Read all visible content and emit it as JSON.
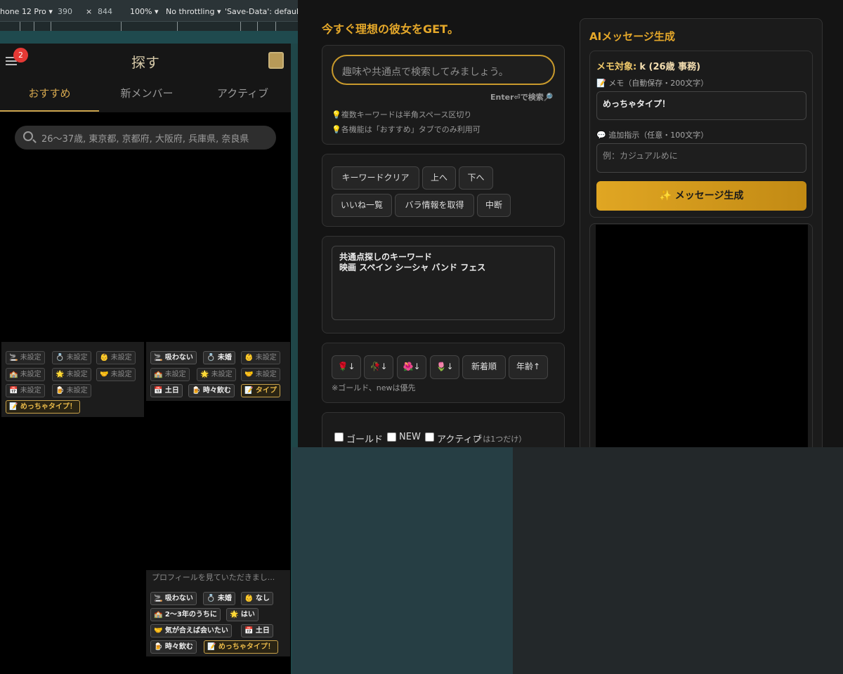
{
  "devtools": {
    "device": "hone 12 Pro",
    "width": "390",
    "x": "×",
    "height": "844",
    "zoom": "100%",
    "throttle": "No throttling",
    "savedata": "'Save-Data': default"
  },
  "app": {
    "badge": "2",
    "title": "探す",
    "tabs": [
      "おすすめ",
      "新メンバー",
      "アクティブ"
    ],
    "search_placeholder": "26〜37歳, 東京都, 京都府, 大阪府, 兵庫県, 奈良県"
  },
  "card1": {
    "tags": [
      "🚬 未設定",
      "💍 未設定",
      "👶 未設定",
      "🏫 未設定",
      "🌟 未設定",
      "🤝 未設定",
      "📅 未設定",
      "🍺 未設定"
    ],
    "memo": "📝 めっちゃタイプ！"
  },
  "card2": {
    "tags": [
      "🚬 吸わない",
      "💍 未婚",
      "👶 未設定",
      "🏫 未設定",
      "🌟 未設定",
      "🤝 未設定",
      "📅 土日",
      "🍺 時々飲む"
    ],
    "type": "📝 タイプ"
  },
  "card3": {
    "message": "プロフィールを見ていただきまし...",
    "tags": [
      "🚬 吸わない",
      "💍 未婚",
      "👶 なし",
      "🏫 2〜3年のうちに",
      "🌟 はい",
      "🤝 気が合えば会いたい",
      "📅 土日",
      "🍺 時々飲む"
    ],
    "memo": "📝 めっちゃタイプ！"
  },
  "panel": {
    "title": "今すぐ理想の彼女をGET。",
    "kw_placeholder": "趣味や共通点で検索してみましょう。",
    "enter_hint": "Enter⏎で検索🔎",
    "note1": "💡複数キーワードは半角スペース区切り",
    "note2": "💡各機能は「おすすめ」タブでのみ利用可",
    "btns": [
      "キーワードクリア",
      "上へ",
      "下へ",
      "いいね一覧",
      "バラ情報を取得",
      "中断"
    ],
    "textarea_line1": "共通点探しのキーワード",
    "textarea_line2": "映画 スペイン シーシャ バンド フェス",
    "sort": [
      "🌹↓",
      "🥀↓",
      "🌺↓",
      "🌷↓",
      "新着順",
      "年齢↑"
    ],
    "sort_note": "※ゴールド、newは優先",
    "filters": [
      "ゴールド",
      "NEW",
      "アクティブ"
    ],
    "filter_note": "（✔は1つだけ）"
  },
  "ai": {
    "title": "AIメッセージ生成",
    "target_label": "メモ対象:",
    "target_value": "k (26歳 事務)",
    "memo_label": "📝 メモ（自動保存・200文字）",
    "memo_value": "めっちゃタイプ！",
    "extra_label": "💬 追加指示（任意・100文字）",
    "extra_placeholder": "例：カジュアルめに",
    "generate": "✨ メッセージ生成"
  }
}
